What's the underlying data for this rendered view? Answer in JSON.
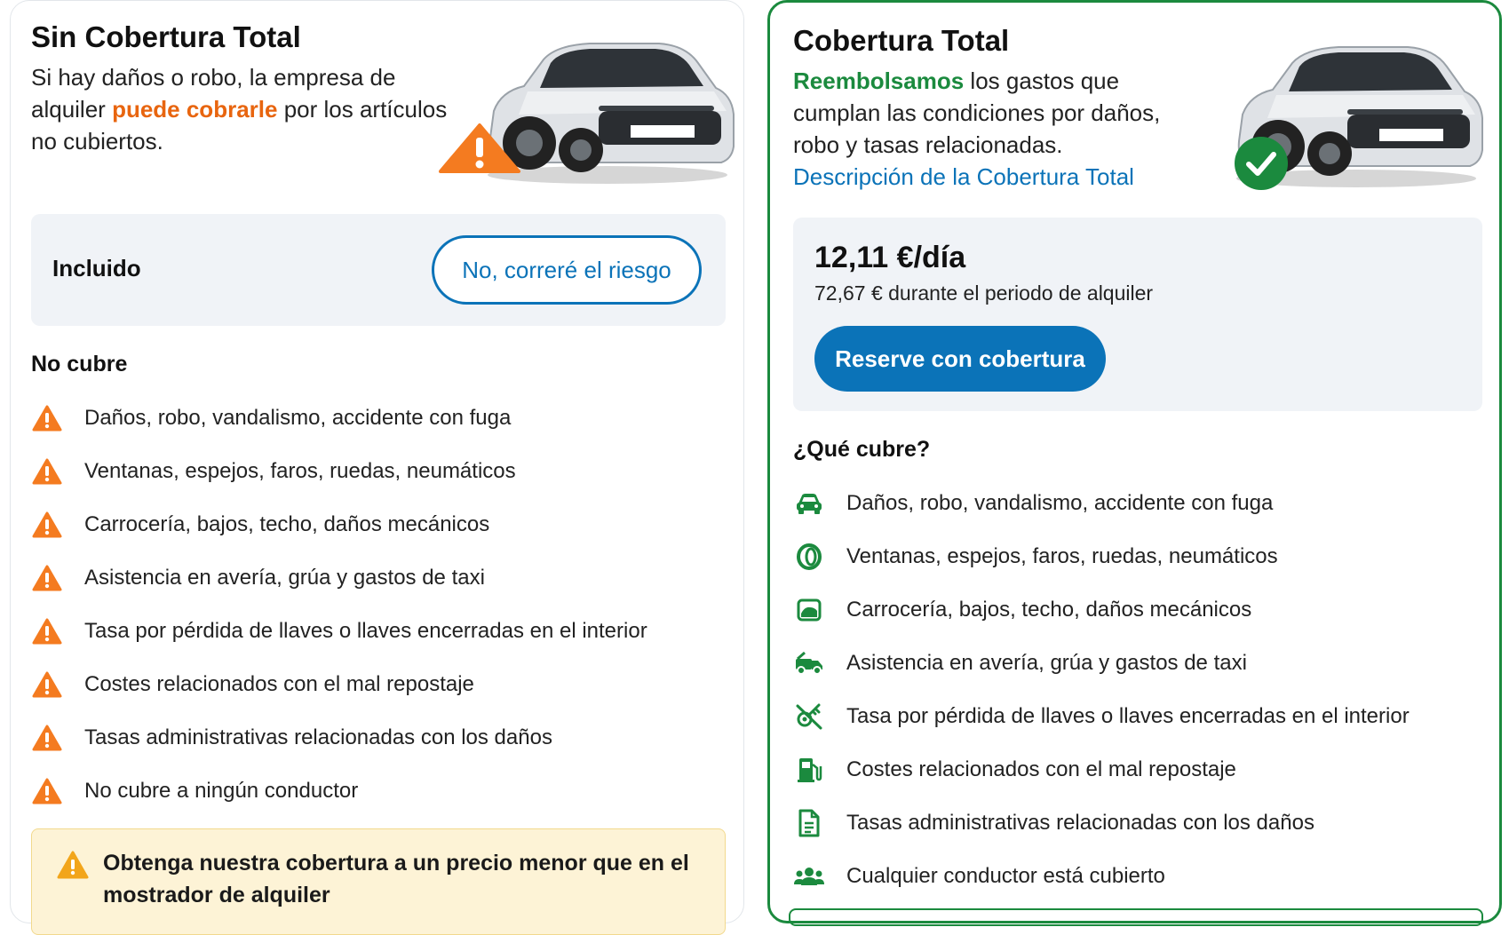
{
  "left_card": {
    "title": "Sin Cobertura Total",
    "desc_before": "Si hay daños o robo, la empresa de alquiler ",
    "desc_highlight": "puede cobrarle",
    "desc_after": " por los artículos no cubiertos.",
    "car_image": "silver-suv-car",
    "badge_icon": "warning-triangle-icon",
    "included_label": "Incluido",
    "risk_button_label": "No, correré el riesgo",
    "section_title": "No cubre",
    "items": [
      {
        "icon": "warning-icon",
        "label": "Daños, robo, vandalismo, accidente con fuga"
      },
      {
        "icon": "warning-icon",
        "label": "Ventanas, espejos, faros, ruedas, neumáticos"
      },
      {
        "icon": "warning-icon",
        "label": "Carrocería, bajos, techo, daños mecánicos"
      },
      {
        "icon": "warning-icon",
        "label": "Asistencia en avería, grúa y gastos de taxi"
      },
      {
        "icon": "warning-icon",
        "label": "Tasa por pérdida de llaves o llaves encerradas en el interior"
      },
      {
        "icon": "warning-icon",
        "label": "Costes relacionados con el mal repostaje"
      },
      {
        "icon": "warning-icon",
        "label": "Tasas administrativas relacionadas con los daños"
      },
      {
        "icon": "warning-icon",
        "label": "No cubre a ningún conductor"
      }
    ],
    "notice_text": "Obtenga nuestra cobertura a un precio menor que en el mostrador de alquiler"
  },
  "right_card": {
    "title": "Cobertura Total",
    "desc_highlight": "Reembolsamos",
    "desc_after": " los gastos que cumplan las condiciones por daños, robo y tasas relacionadas.",
    "desc_link": "Descripción de la Cobertura Total",
    "car_image": "silver-suv-car",
    "badge_icon": "check-circle-icon",
    "price_per_day": "12,11 €/día",
    "price_total": "72,67 € durante el periodo de alquiler",
    "book_button_label": "Reserve con cobertura",
    "section_title": "¿Qué cubre?",
    "items": [
      {
        "icon": "car-front-icon",
        "label": "Daños, robo, vandalismo, accidente con fuga"
      },
      {
        "icon": "tire-icon",
        "label": "Ventanas, espejos, faros, ruedas, neumáticos"
      },
      {
        "icon": "car-body-icon",
        "label": "Carrocería, bajos, techo, daños mecánicos"
      },
      {
        "icon": "tow-truck-icon",
        "label": "Asistencia en avería, grúa y gastos de taxi"
      },
      {
        "icon": "keys-icon",
        "label": "Tasa por pérdida de llaves o llaves encerradas en el interior"
      },
      {
        "icon": "fuel-pump-icon",
        "label": "Costes relacionados con el mal repostaje"
      },
      {
        "icon": "document-icon",
        "label": "Tasas administrativas relacionadas con los daños"
      },
      {
        "icon": "users-icon",
        "label": "Cualquier conductor está cubierto"
      }
    ]
  },
  "colors": {
    "accent_blue": "#0b73b8",
    "accent_green": "#1b8a3e",
    "warning_orange": "#f47b20",
    "highlight_orange": "#e8650f",
    "notice_bg": "#fdf3d6",
    "box_bg": "#f0f3f7"
  }
}
